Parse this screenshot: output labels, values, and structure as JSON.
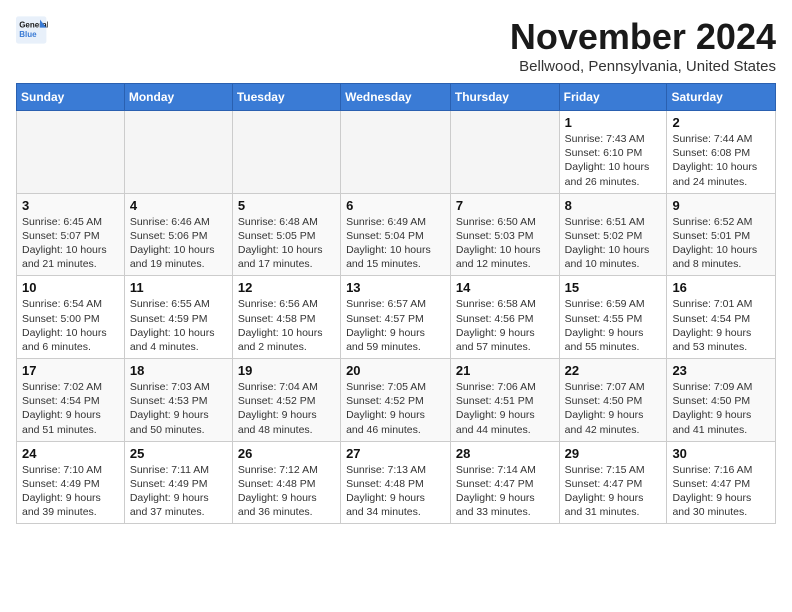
{
  "logo": {
    "line1": "General",
    "line2": "Blue"
  },
  "title": "November 2024",
  "location": "Bellwood, Pennsylvania, United States",
  "days_of_week": [
    "Sunday",
    "Monday",
    "Tuesday",
    "Wednesday",
    "Thursday",
    "Friday",
    "Saturday"
  ],
  "weeks": [
    [
      {
        "day": null
      },
      {
        "day": null
      },
      {
        "day": null
      },
      {
        "day": null
      },
      {
        "day": null
      },
      {
        "day": 1,
        "sunrise": "7:43 AM",
        "sunset": "6:10 PM",
        "daylight": "10 hours and 26 minutes."
      },
      {
        "day": 2,
        "sunrise": "7:44 AM",
        "sunset": "6:08 PM",
        "daylight": "10 hours and 24 minutes."
      }
    ],
    [
      {
        "day": 3,
        "sunrise": "6:45 AM",
        "sunset": "5:07 PM",
        "daylight": "10 hours and 21 minutes."
      },
      {
        "day": 4,
        "sunrise": "6:46 AM",
        "sunset": "5:06 PM",
        "daylight": "10 hours and 19 minutes."
      },
      {
        "day": 5,
        "sunrise": "6:48 AM",
        "sunset": "5:05 PM",
        "daylight": "10 hours and 17 minutes."
      },
      {
        "day": 6,
        "sunrise": "6:49 AM",
        "sunset": "5:04 PM",
        "daylight": "10 hours and 15 minutes."
      },
      {
        "day": 7,
        "sunrise": "6:50 AM",
        "sunset": "5:03 PM",
        "daylight": "10 hours and 12 minutes."
      },
      {
        "day": 8,
        "sunrise": "6:51 AM",
        "sunset": "5:02 PM",
        "daylight": "10 hours and 10 minutes."
      },
      {
        "day": 9,
        "sunrise": "6:52 AM",
        "sunset": "5:01 PM",
        "daylight": "10 hours and 8 minutes."
      }
    ],
    [
      {
        "day": 10,
        "sunrise": "6:54 AM",
        "sunset": "5:00 PM",
        "daylight": "10 hours and 6 minutes."
      },
      {
        "day": 11,
        "sunrise": "6:55 AM",
        "sunset": "4:59 PM",
        "daylight": "10 hours and 4 minutes."
      },
      {
        "day": 12,
        "sunrise": "6:56 AM",
        "sunset": "4:58 PM",
        "daylight": "10 hours and 2 minutes."
      },
      {
        "day": 13,
        "sunrise": "6:57 AM",
        "sunset": "4:57 PM",
        "daylight": "9 hours and 59 minutes."
      },
      {
        "day": 14,
        "sunrise": "6:58 AM",
        "sunset": "4:56 PM",
        "daylight": "9 hours and 57 minutes."
      },
      {
        "day": 15,
        "sunrise": "6:59 AM",
        "sunset": "4:55 PM",
        "daylight": "9 hours and 55 minutes."
      },
      {
        "day": 16,
        "sunrise": "7:01 AM",
        "sunset": "4:54 PM",
        "daylight": "9 hours and 53 minutes."
      }
    ],
    [
      {
        "day": 17,
        "sunrise": "7:02 AM",
        "sunset": "4:54 PM",
        "daylight": "9 hours and 51 minutes."
      },
      {
        "day": 18,
        "sunrise": "7:03 AM",
        "sunset": "4:53 PM",
        "daylight": "9 hours and 50 minutes."
      },
      {
        "day": 19,
        "sunrise": "7:04 AM",
        "sunset": "4:52 PM",
        "daylight": "9 hours and 48 minutes."
      },
      {
        "day": 20,
        "sunrise": "7:05 AM",
        "sunset": "4:52 PM",
        "daylight": "9 hours and 46 minutes."
      },
      {
        "day": 21,
        "sunrise": "7:06 AM",
        "sunset": "4:51 PM",
        "daylight": "9 hours and 44 minutes."
      },
      {
        "day": 22,
        "sunrise": "7:07 AM",
        "sunset": "4:50 PM",
        "daylight": "9 hours and 42 minutes."
      },
      {
        "day": 23,
        "sunrise": "7:09 AM",
        "sunset": "4:50 PM",
        "daylight": "9 hours and 41 minutes."
      }
    ],
    [
      {
        "day": 24,
        "sunrise": "7:10 AM",
        "sunset": "4:49 PM",
        "daylight": "9 hours and 39 minutes."
      },
      {
        "day": 25,
        "sunrise": "7:11 AM",
        "sunset": "4:49 PM",
        "daylight": "9 hours and 37 minutes."
      },
      {
        "day": 26,
        "sunrise": "7:12 AM",
        "sunset": "4:48 PM",
        "daylight": "9 hours and 36 minutes."
      },
      {
        "day": 27,
        "sunrise": "7:13 AM",
        "sunset": "4:48 PM",
        "daylight": "9 hours and 34 minutes."
      },
      {
        "day": 28,
        "sunrise": "7:14 AM",
        "sunset": "4:47 PM",
        "daylight": "9 hours and 33 minutes."
      },
      {
        "day": 29,
        "sunrise": "7:15 AM",
        "sunset": "4:47 PM",
        "daylight": "9 hours and 31 minutes."
      },
      {
        "day": 30,
        "sunrise": "7:16 AM",
        "sunset": "4:47 PM",
        "daylight": "9 hours and 30 minutes."
      }
    ]
  ]
}
